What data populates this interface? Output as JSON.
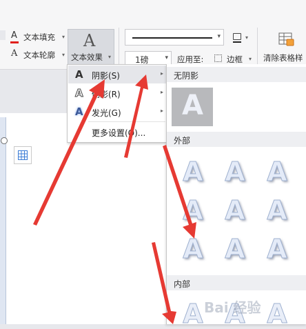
{
  "ribbon": {
    "text_fill": "文本填充",
    "text_outline": "文本轮廓",
    "text_effects": "文本效果",
    "line_weight": "1磅",
    "apply_to_label": "应用至:",
    "apply_to_value": "边框",
    "clear_table_style": "清除表格样"
  },
  "menu": {
    "items": [
      {
        "icon": "A",
        "label": "阴影(S)",
        "has_submenu": true
      },
      {
        "icon": "A",
        "label": "倒影(R)",
        "has_submenu": true
      },
      {
        "icon": "A",
        "label": "发光(G)",
        "has_submenu": true
      },
      {
        "label": "更多设置(O)...",
        "has_submenu": false
      }
    ]
  },
  "gallery": {
    "no_shadow_header": "无阴影",
    "no_shadow_glyph": "A",
    "outer_header": "外部",
    "inner_header": "内部",
    "glyph": "A"
  },
  "watermark": "Bai 经验",
  "colors": {
    "text_fill_bar": "#e0201c",
    "arrow_red": "#e63a33",
    "menu_hover": "#e5e6ea"
  }
}
